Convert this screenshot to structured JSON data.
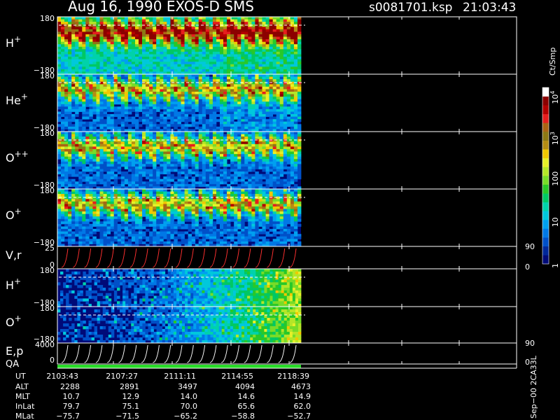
{
  "header": {
    "title": "Aug 16, 1990    EXOS-D SMS",
    "file": "s0081701.ksp",
    "time": "21:03:43"
  },
  "colorbar": {
    "unit": "Ct/Smp",
    "ticks": [
      {
        "label": "1",
        "value": 1
      },
      {
        "label": "10",
        "value": 10
      },
      {
        "label": "100",
        "value": 100
      },
      {
        "label": "10",
        "exp": "3",
        "value": 1000
      },
      {
        "label": "10",
        "exp": "4",
        "value": 10000
      }
    ],
    "colors": [
      "#000a78",
      "#00289a",
      "#0050c8",
      "#0078e6",
      "#00a0f0",
      "#00c8dc",
      "#00d2aa",
      "#00c864",
      "#28c828",
      "#78dc28",
      "#b4e628",
      "#e6f028",
      "#f0c800",
      "#b48c14",
      "#8c7814",
      "#aa6414",
      "#e61e1e",
      "#b40000",
      "#8c0000",
      "#ffffff"
    ]
  },
  "panels": [
    {
      "id": "h-plus",
      "label": "H",
      "sup": "+",
      "ticks": [
        "180",
        "−180"
      ],
      "style": "spectro",
      "ylim": [
        -180,
        180
      ],
      "dashed_y": 180
    },
    {
      "id": "he-plus",
      "label": "He",
      "sup": "+",
      "ticks": [
        "180",
        "−180"
      ],
      "style": "spectro",
      "ylim": [
        -180,
        180
      ],
      "dashed_y": 180
    },
    {
      "id": "o-plusplus",
      "label": "O",
      "sup": "++",
      "ticks": [
        "180",
        "−180"
      ],
      "style": "spectro",
      "ylim": [
        -180,
        180
      ],
      "dashed_y": 180
    },
    {
      "id": "o-plus",
      "label": "O",
      "sup": "+",
      "ticks": [
        "180",
        "−180"
      ],
      "style": "spectro",
      "ylim": [
        -180,
        180
      ],
      "dashed_y": 180
    },
    {
      "id": "v-r",
      "label": "V,r",
      "sup": "",
      "ticks": [
        "25",
        "0"
      ],
      "right_ticks": [
        "90",
        "0"
      ],
      "style": "curves",
      "curve_color": "#ff3030",
      "ylim": [
        0,
        25
      ]
    },
    {
      "id": "h-plus-2",
      "label": "H",
      "sup": "+",
      "ticks": [
        "180",
        "−180"
      ],
      "style": "noise",
      "ylim": [
        -180,
        180
      ],
      "dashed_y": 180
    },
    {
      "id": "o-plus-2",
      "label": "O",
      "sup": "+",
      "ticks": [
        "180",
        "−180"
      ],
      "style": "noise",
      "ylim": [
        -180,
        180
      ],
      "dashed_y": 180
    },
    {
      "id": "e-p",
      "label": "E,p",
      "sup": "",
      "ticks": [
        "4000",
        "0"
      ],
      "right_ticks": [
        "90",
        "0"
      ],
      "style": "curves",
      "curve_color": "#ffffff",
      "ylim": [
        0,
        4000
      ]
    }
  ],
  "qa_label": "QA",
  "qa_color": "#28dc28",
  "ephemeris": {
    "labels": [
      "UT",
      "ALT",
      "MLT",
      "InLat",
      "MLat"
    ],
    "columns": [
      [
        "2103:43",
        "2288",
        "10.7",
        "79.7",
        "−75.7"
      ],
      [
        "2107:27",
        "2891",
        "12.9",
        "75.1",
        "−71.5"
      ],
      [
        "2111:11",
        "3497",
        "14.0",
        "70.0",
        "−65.2"
      ],
      [
        "2114:55",
        "4094",
        "14.6",
        "65.6",
        "−58.8"
      ],
      [
        "2118:39",
        "4673",
        "14.9",
        "62.0",
        "−52.7"
      ]
    ]
  },
  "footer_vertical": "Sep−00 2CA33L"
}
